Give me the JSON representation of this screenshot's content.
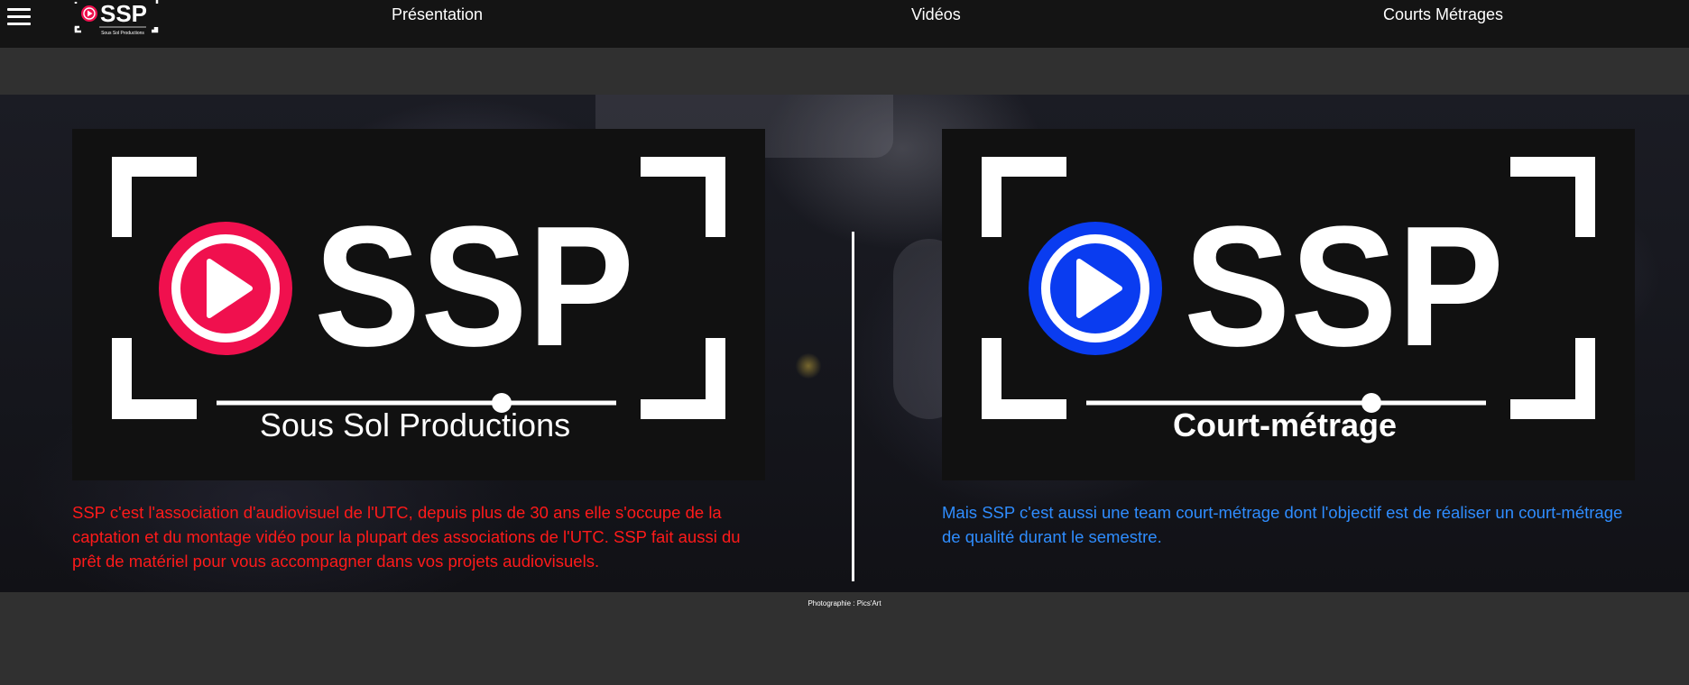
{
  "nav": {
    "logo_text": "SSP",
    "logo_subtext": "Sous Sol Productions",
    "links": [
      "Présentation",
      "Vidéos",
      "Courts Métrages"
    ]
  },
  "cards": [
    {
      "logo_text": "SSP",
      "logo_caption": "Sous Sol Productions",
      "accent_color": "#f0104e",
      "description": "SSP c'est l'association d'audiovisuel de l'UTC, depuis plus de 30 ans elle s'occupe de la captation et du montage vidéo pour la plupart des associations de l'UTC. SSP fait aussi du prêt de matériel pour vous accompagner dans vos projets audiovisuels.",
      "text_color": "#ff1a1a"
    },
    {
      "logo_text": "SSP",
      "logo_caption": "Court-métrage",
      "accent_color": "#0a3cf0",
      "description": "Mais SSP c'est aussi une team court-métrage dont l'objectif est de réaliser un court-métrage de qualité durant le semestre.",
      "text_color": "#2f8dff"
    }
  ],
  "footer": {
    "credit": "Photographie : Pics'Art"
  },
  "icons": {
    "menu": "hamburger-icon",
    "play": "play-icon"
  }
}
